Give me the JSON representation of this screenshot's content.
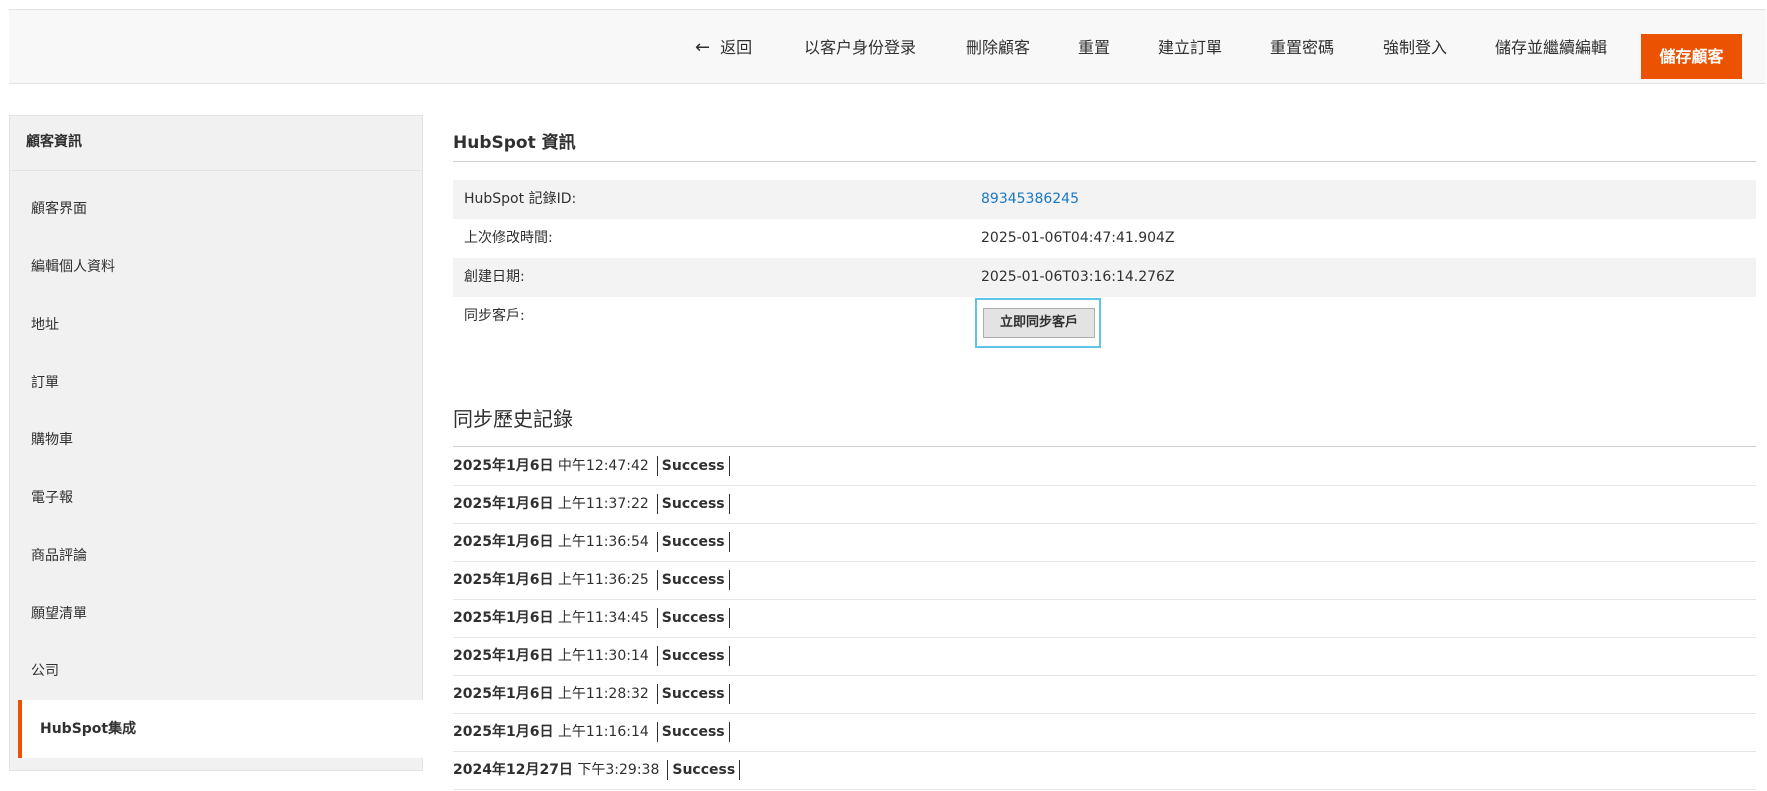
{
  "actions": {
    "back": "返回",
    "login_as_customer": "以客户身份登录",
    "delete_customer": "刪除顧客",
    "reset": "重置",
    "create_order": "建立訂單",
    "reset_password": "重置密碼",
    "force_login": "強制登入",
    "save_and_continue": "儲存並繼續編輯",
    "save_customer": "儲存顧客"
  },
  "sidebar": {
    "title": "顧客資訊",
    "items": [
      {
        "label": "顧客界面"
      },
      {
        "label": "編輯個人資料"
      },
      {
        "label": "地址"
      },
      {
        "label": "訂單"
      },
      {
        "label": "購物車"
      },
      {
        "label": "電子報"
      },
      {
        "label": "商品評論"
      },
      {
        "label": "願望清單"
      },
      {
        "label": "公司"
      },
      {
        "label": "HubSpot集成"
      }
    ],
    "active_index": 9
  },
  "hubspot": {
    "title": "HubSpot 資訊",
    "record_id_label": "HubSpot 記錄ID:",
    "record_id_value": "89345386245",
    "last_modified_label": "上次修改時間:",
    "last_modified_value": "2025-01-06T04:47:41.904Z",
    "created_label": "創建日期:",
    "created_value": "2025-01-06T03:16:14.276Z",
    "sync_label": "同步客戶:",
    "sync_button": "立即同步客戶"
  },
  "history": {
    "title": "同步歷史記錄",
    "rows": [
      {
        "date": "2025年1月6日",
        "time": "中午12:47:42",
        "status": "Success"
      },
      {
        "date": "2025年1月6日",
        "time": "上午11:37:22",
        "status": "Success"
      },
      {
        "date": "2025年1月6日",
        "time": "上午11:36:54",
        "status": "Success"
      },
      {
        "date": "2025年1月6日",
        "time": "上午11:36:25",
        "status": "Success"
      },
      {
        "date": "2025年1月6日",
        "time": "上午11:34:45",
        "status": "Success"
      },
      {
        "date": "2025年1月6日",
        "time": "上午11:30:14",
        "status": "Success"
      },
      {
        "date": "2025年1月6日",
        "time": "上午11:28:32",
        "status": "Success"
      },
      {
        "date": "2025年1月6日",
        "time": "上午11:16:14",
        "status": "Success"
      },
      {
        "date": "2024年12月27日",
        "time": "下午3:29:38",
        "status": "Success"
      }
    ]
  },
  "colors": {
    "accent": "#eb5202",
    "link": "#1979c3",
    "focus": "#61c3e7"
  },
  "icons": {
    "back": "arrow-left-icon"
  }
}
